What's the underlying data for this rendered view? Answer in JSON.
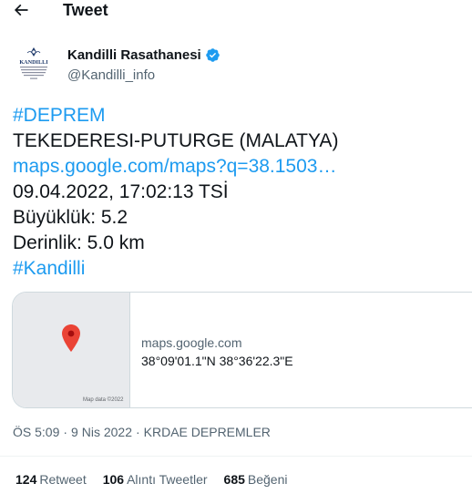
{
  "header": {
    "back_icon": "arrow-left-icon",
    "title": "Tweet"
  },
  "author": {
    "name": "Kandilli Rasathanesi",
    "handle": "@Kandilli_info",
    "verified_icon": "verified-badge-icon",
    "avatar_logo_text": "KANDILLI",
    "verified_color": "#1d9bf0"
  },
  "tweet": {
    "lines": [
      "#DEPREM",
      "TEKEDERESI-PUTURGE (MALATYA)",
      "maps.google.com/maps?q=38.1503…",
      "09.04.2022, 17:02:13 TSİ",
      "Büyüklük: 5.2",
      "Derinlik: 5.0 km",
      "#Kandilli"
    ]
  },
  "card": {
    "domain": "maps.google.com",
    "coordinates": "38°09'01.1\"N 38°36'22.3\"E",
    "map_credit": "Map data ©2022",
    "pin_icon": "map-pin-icon",
    "pin_color": "#ea4335"
  },
  "meta": {
    "time": "ÖS 5:09",
    "separator": "·",
    "date": "9 Nis 2022",
    "source": "KRDAE DEPREMLER"
  },
  "stats": {
    "retweets_count": "124",
    "retweets_label": "Retweet",
    "quotes_count": "106",
    "quotes_label": "Alıntı Tweetler",
    "likes_count": "685",
    "likes_label": "Beğeni"
  },
  "colors": {
    "link": "#1d9bf0",
    "text": "#0f1419",
    "secondary": "#536471",
    "border": "#cfd9de"
  }
}
